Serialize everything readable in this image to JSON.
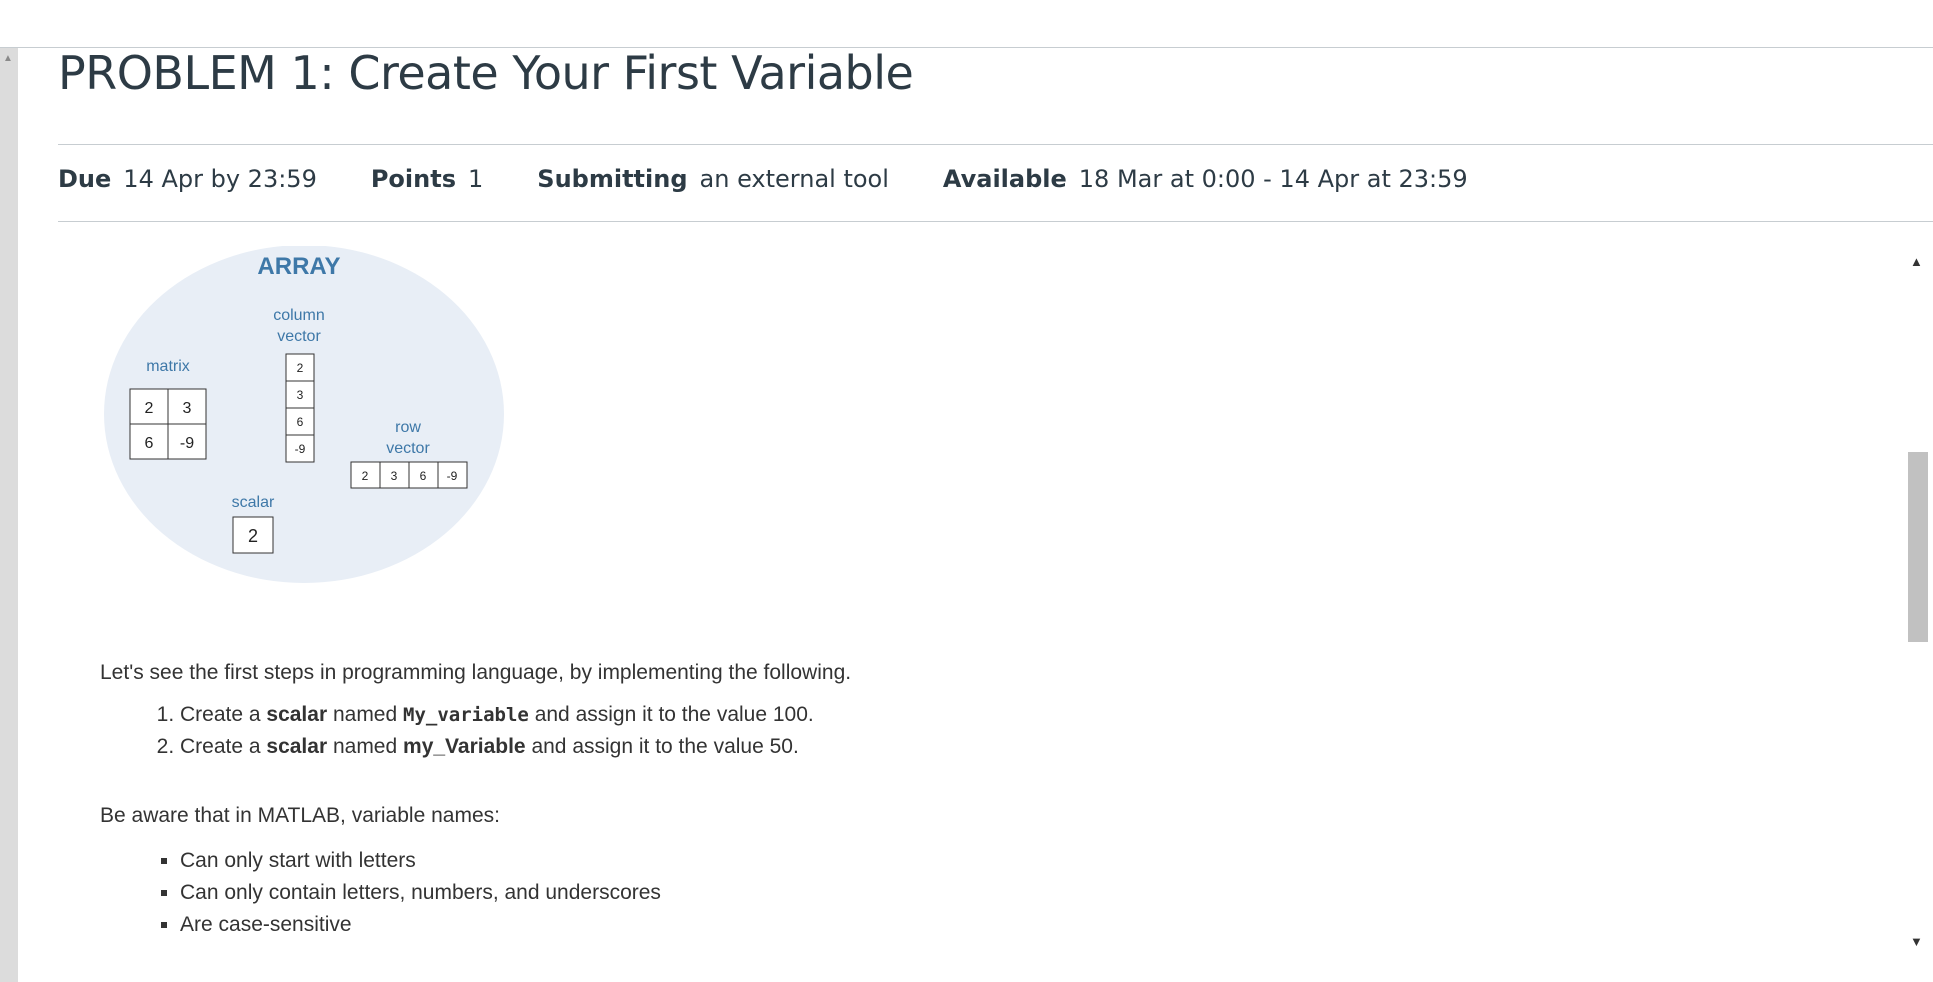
{
  "title": "PROBLEM 1: Create Your First Variable",
  "meta": {
    "due_label": "Due",
    "due_value": "14 Apr by 23:59",
    "points_label": "Points",
    "points_value": "1",
    "submitting_label": "Submitting",
    "submitting_value": "an external tool",
    "available_label": "Available",
    "available_value": "18 Mar at 0:00 - 14 Apr at 23:59"
  },
  "diagram": {
    "title": "ARRAY",
    "matrix_label": "matrix",
    "matrix": [
      "2",
      "3",
      "6",
      "-9"
    ],
    "column_label_1": "column",
    "column_label_2": "vector",
    "column": [
      "2",
      "3",
      "6",
      "-9"
    ],
    "row_label_1": "row",
    "row_label_2": "vector",
    "row": [
      "2",
      "3",
      "6",
      "-9"
    ],
    "scalar_label": "scalar",
    "scalar": "2"
  },
  "intro": "Let's see the first steps in programming language, by implementing the following.",
  "steps": [
    {
      "pre": "Create a ",
      "bold1": "scalar",
      "mid": " named ",
      "code": "My_variable",
      "post": " and assign it to the value 100."
    },
    {
      "pre": "Create a ",
      "bold1": "scalar",
      "mid": " named ",
      "code": "my_Variable",
      "post": " and assign it to the value 50."
    }
  ],
  "aware": "Be aware that in MATLAB, variable names:",
  "rules": [
    "Can only start with letters",
    "Can only contain letters, numbers, and underscores",
    "Are case-sensitive"
  ]
}
